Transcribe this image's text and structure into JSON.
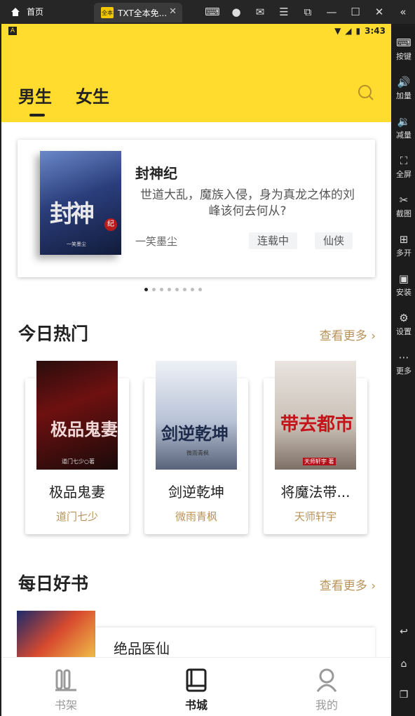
{
  "emulator": {
    "home_tab_label": "首页",
    "app_tab_label": "TXT全本免...",
    "app_icon_text": "全本",
    "side_buttons": [
      "按键",
      "加量",
      "减量",
      "全屏",
      "截图",
      "多开",
      "安装",
      "设置",
      "更多"
    ]
  },
  "statusbar": {
    "time": "3:43"
  },
  "header": {
    "tabs": [
      {
        "label": "男生",
        "active": true
      },
      {
        "label": "女生",
        "active": false
      }
    ]
  },
  "banner": {
    "cover_title": "封神",
    "cover_seal": "纪",
    "cover_author": "一笑墨尘",
    "title": "封神纪",
    "description": "世道大乱，魔族入侵，身为真龙之体的刘峰该何去何从?",
    "author": "一笑墨尘",
    "tags": [
      "连载中",
      "仙侠"
    ],
    "page_count": 8,
    "current_page": 1
  },
  "hot": {
    "title": "今日热门",
    "more_label": "查看更多",
    "books": [
      {
        "title": "极品鬼妻",
        "author": "道门七少",
        "cover_title": "极品鬼妻",
        "cover_author": "道门七少○著"
      },
      {
        "title": "剑逆乾坤",
        "author": "微雨青枫",
        "cover_title": "剑逆乾坤",
        "cover_author": "微雨青枫"
      },
      {
        "title": "将魔法带...",
        "author": "天师轩宇",
        "cover_title": "带去都市",
        "cover_author": "天师轩宇 著"
      }
    ]
  },
  "daily": {
    "title": "每日好书",
    "more_label": "查看更多",
    "book": {
      "title": "绝品医仙"
    }
  },
  "bottom_nav": [
    {
      "label": "书架",
      "icon": "bookshelf-icon",
      "active": false
    },
    {
      "label": "书城",
      "icon": "book-icon",
      "active": true
    },
    {
      "label": "我的",
      "icon": "user-icon",
      "active": false
    }
  ],
  "colors": {
    "accent_yellow": "#ffdc2e",
    "gold_text": "#b9935a"
  }
}
